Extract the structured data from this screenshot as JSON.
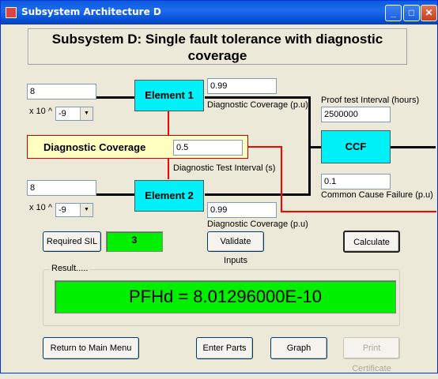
{
  "window": {
    "title": "Subsystem Architecture D",
    "minimize_glyph": "_",
    "maximize_glyph": "□",
    "close_glyph": "✕"
  },
  "header": {
    "title": "Subsystem D: Single fault tolerance with diagnostic coverage"
  },
  "element1": {
    "label": "Element 1",
    "rate_value": "8",
    "exp_label": "x 10 ^",
    "exp_value": "-9",
    "dc_value": "0.99",
    "dc_label": "Diagnostic Coverage (p.u)"
  },
  "element2": {
    "label": "Element 2",
    "rate_value": "8",
    "exp_label": "x 10 ^",
    "exp_value": "-9",
    "dc_value": "0.99",
    "dc_label": "Diagnostic Coverage (p.u)"
  },
  "diagnostic": {
    "label": "Diagnostic Coverage",
    "value": "0.5",
    "interval_label": "Diagnostic Test Interval (s)"
  },
  "ccf": {
    "label": "CCF",
    "proof_label": "Proof test Interval (hours)",
    "proof_value": "2500000",
    "common_value": "0.1",
    "common_label": "Common Cause Failure (p.u)"
  },
  "sil": {
    "button": "Required SIL",
    "value": "3"
  },
  "validate_button": "Validate Inputs",
  "calculate_button": "Calculate",
  "result": {
    "group_label": "Result.....",
    "text": "PFHd = 8.01296000E-10"
  },
  "footer": {
    "return": "Return to Main Menu",
    "enter_parts": "Enter Parts",
    "graph": "Graph",
    "print": "Print Certificate"
  },
  "colors": {
    "element": "#00f0f8",
    "diag_box": "#ffffc0",
    "result": "#00f000",
    "signal_line": "#ff0000"
  }
}
